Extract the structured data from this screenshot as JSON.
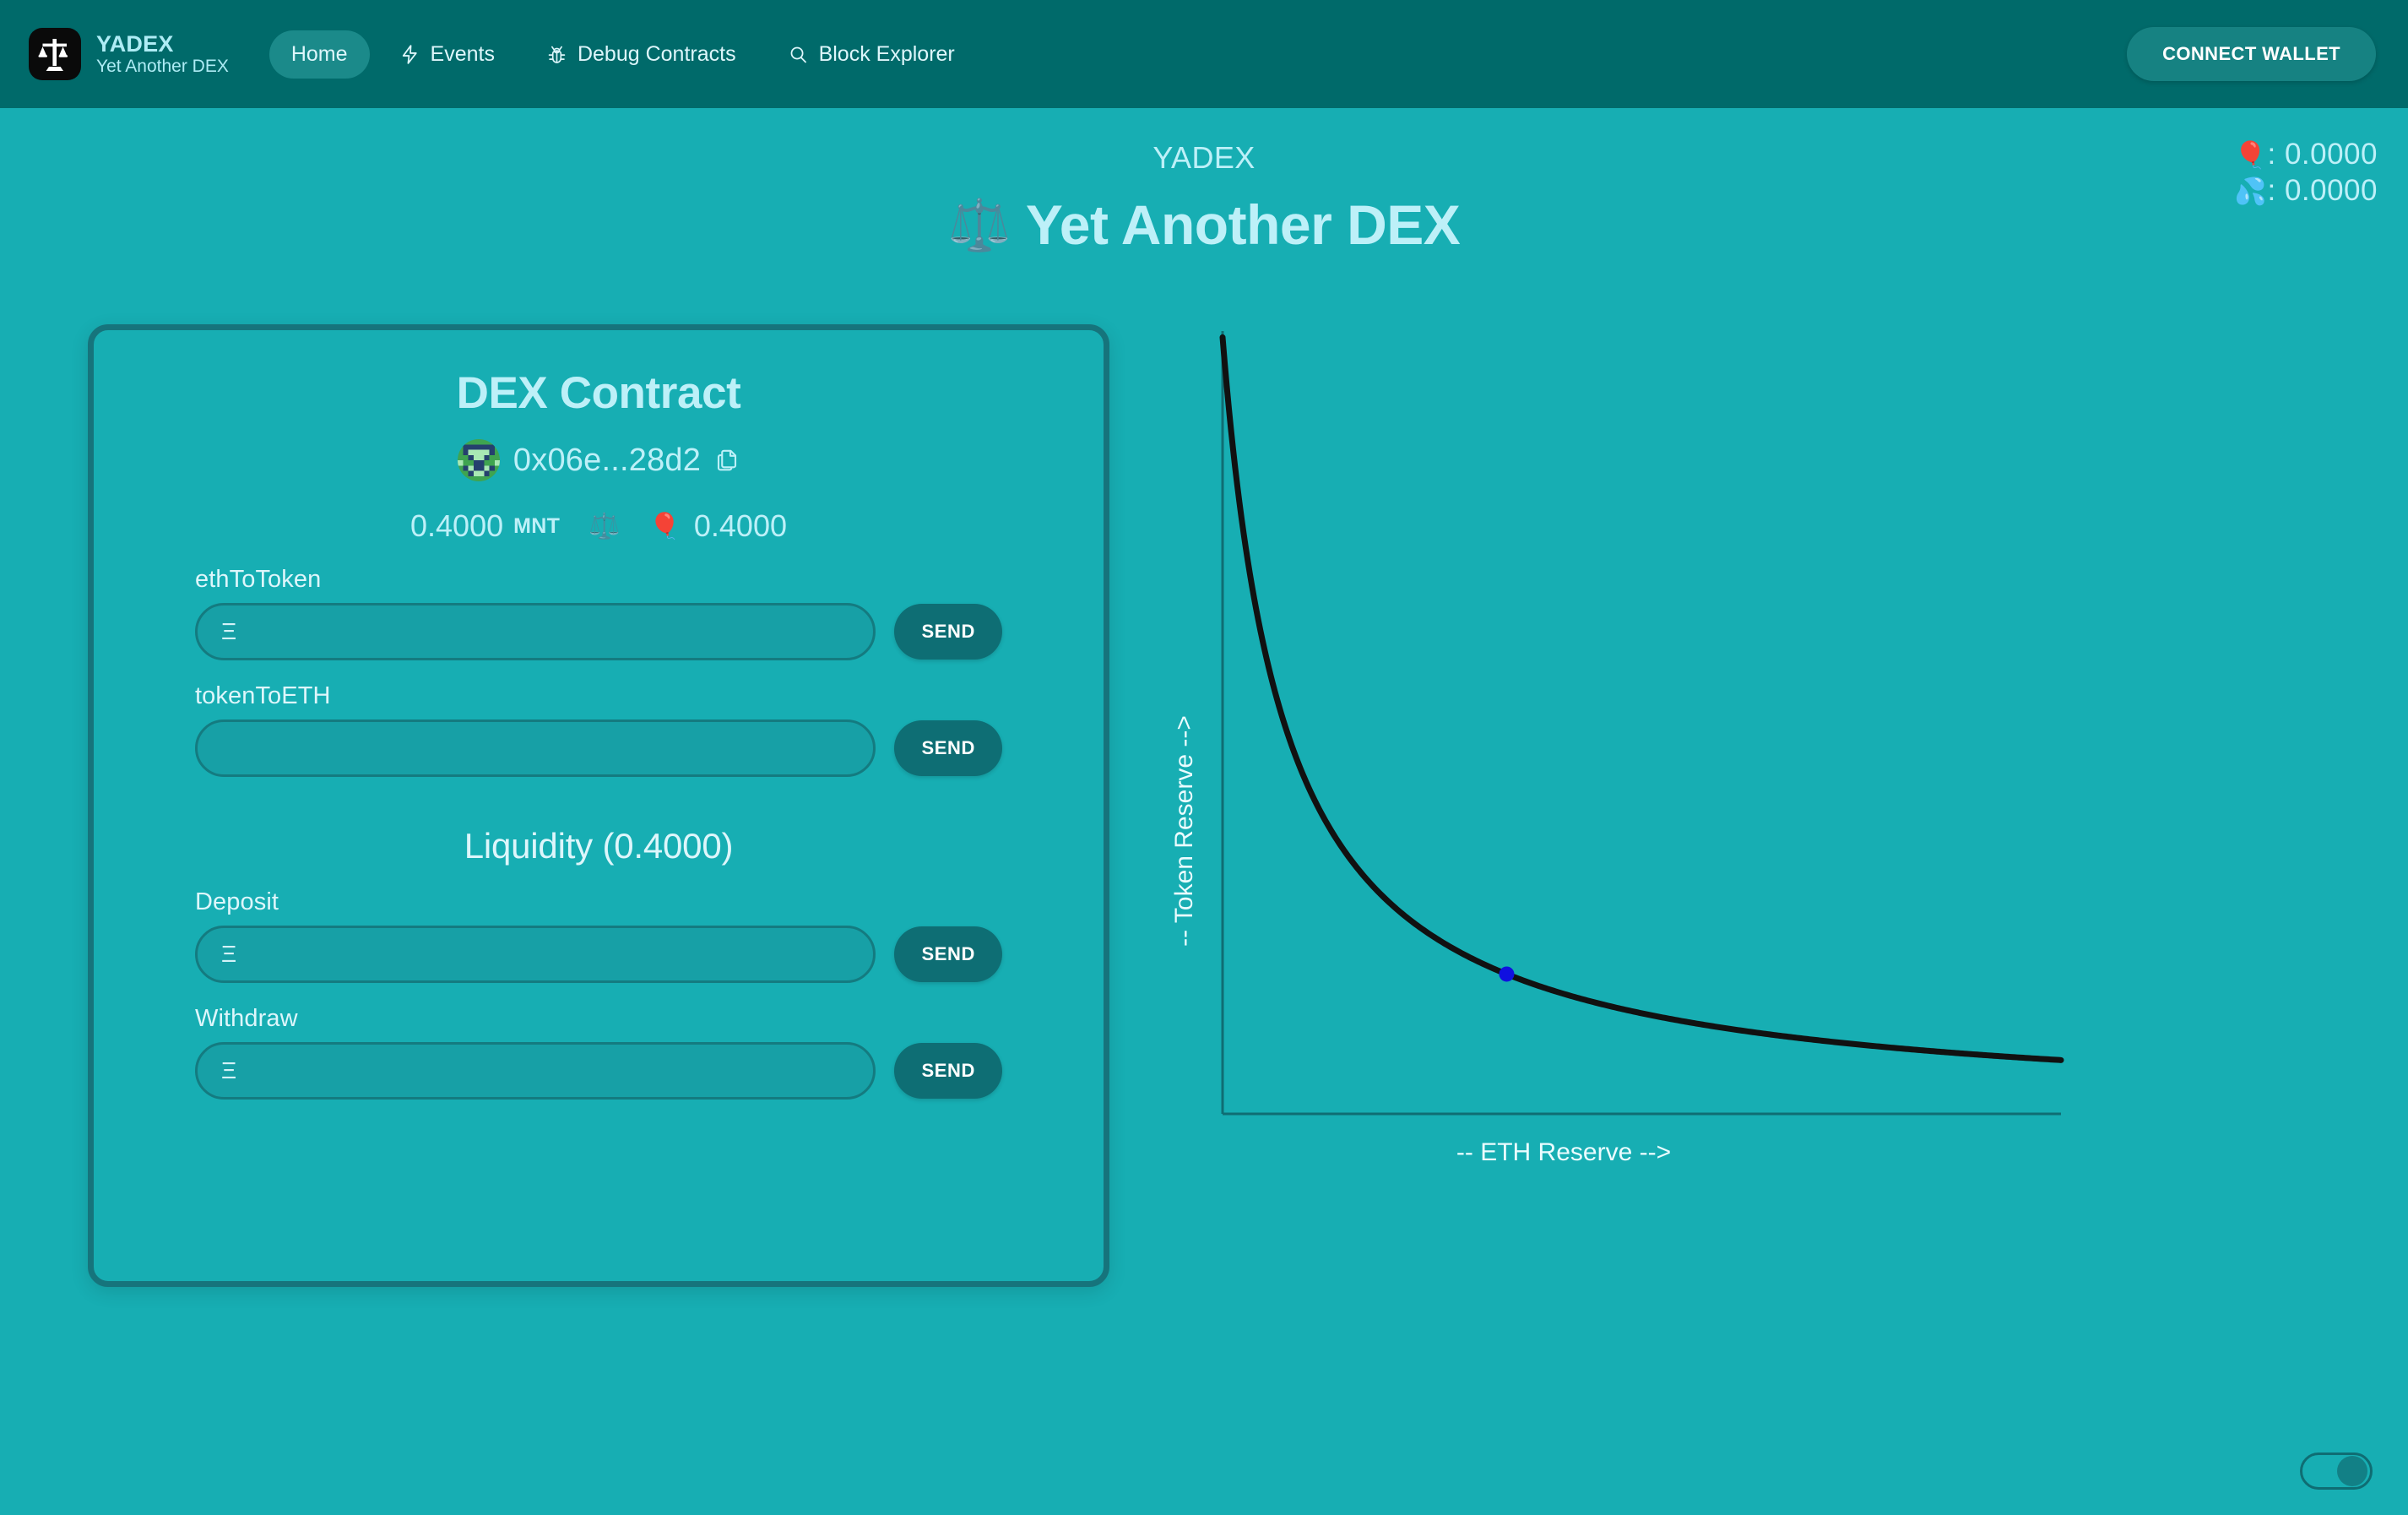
{
  "brand": {
    "name": "YADEX",
    "tagline": "Yet Another DEX",
    "logo_icon": "balance-scale-eth-logo"
  },
  "nav": {
    "items": [
      {
        "label": "Home",
        "icon": "",
        "active": true
      },
      {
        "label": "Events",
        "icon": "lightning-bolt-icon",
        "active": false
      },
      {
        "label": "Debug Contracts",
        "icon": "bug-icon",
        "active": false
      },
      {
        "label": "Block Explorer",
        "icon": "search-icon",
        "active": false
      }
    ],
    "connect_wallet_label": "CONNECT WALLET"
  },
  "balances": {
    "eth": {
      "emoji": "🎈",
      "icon_name": "balloon-emoji",
      "separator": ": ",
      "value": "0.0000"
    },
    "token": {
      "emoji": "💦",
      "icon_name": "sweat-droplets-emoji",
      "separator": ": ",
      "value": "0.0000"
    }
  },
  "hero": {
    "eyebrow": "YADEX",
    "emoji": "⚖️",
    "emoji_name": "balance-scale-emoji",
    "title": "Yet Another DEX"
  },
  "dex_card": {
    "title": "DEX Contract",
    "address": "0x06e...28d2",
    "copy_icon": "copy-document-icon",
    "avatar": "blockie-identicon",
    "reserves": {
      "eth_amount": "0.4000",
      "eth_unit": "MNT",
      "scale_emoji": "⚖️",
      "token_emoji": "🎈",
      "token_amount": "0.4000"
    },
    "fields": [
      {
        "label": "ethToToken",
        "value": "",
        "placeholder": "Ξ",
        "button": "SEND"
      },
      {
        "label": "tokenToETH",
        "value": "",
        "placeholder": "",
        "button": "SEND"
      }
    ],
    "liquidity": {
      "title": "Liquidity (0.4000)",
      "fields": [
        {
          "label": "Deposit",
          "value": "",
          "placeholder": "Ξ",
          "button": "SEND"
        },
        {
          "label": "Withdraw",
          "value": "",
          "placeholder": "Ξ",
          "button": "SEND"
        }
      ]
    }
  },
  "theme_toggle": {
    "name": "dark-mode-toggle",
    "state": "on"
  },
  "colors": {
    "page_bg": "#17aeb3",
    "nav_bg": "#006a6a",
    "accent_text": "#bdf0f8",
    "card_border": "#16747c",
    "button_bg": "#0e6e74",
    "curve_stroke": "#111111",
    "marker": "#1010e0"
  },
  "chart_data": {
    "type": "line",
    "title": "",
    "xlabel": "-- ETH Reserve -->",
    "ylabel": "-- Token Reserve -->",
    "curve_formula": "x * y = k (constant product)",
    "k": 1.0,
    "xlim": [
      0.18,
      2.6
    ],
    "ylim": [
      0.0,
      5.6
    ],
    "grid": false,
    "legend": null,
    "series": [
      {
        "name": "Constant product curve",
        "x": [
          0.18,
          0.22,
          0.26,
          0.3,
          0.35,
          0.4,
          0.45,
          0.5,
          0.6,
          0.7,
          0.8,
          0.9,
          1.0,
          1.2,
          1.4,
          1.6,
          1.8,
          2.0,
          2.2,
          2.4,
          2.6
        ],
        "y": [
          5.56,
          4.55,
          3.85,
          3.33,
          2.86,
          2.5,
          2.22,
          2.0,
          1.67,
          1.43,
          1.25,
          1.11,
          1.0,
          0.83,
          0.71,
          0.63,
          0.56,
          0.5,
          0.45,
          0.42,
          0.38
        ]
      }
    ],
    "markers": [
      {
        "name": "current-reserve-point",
        "x": 1.0,
        "y": 1.0,
        "color": "#1010e0",
        "radius": 9
      }
    ]
  }
}
